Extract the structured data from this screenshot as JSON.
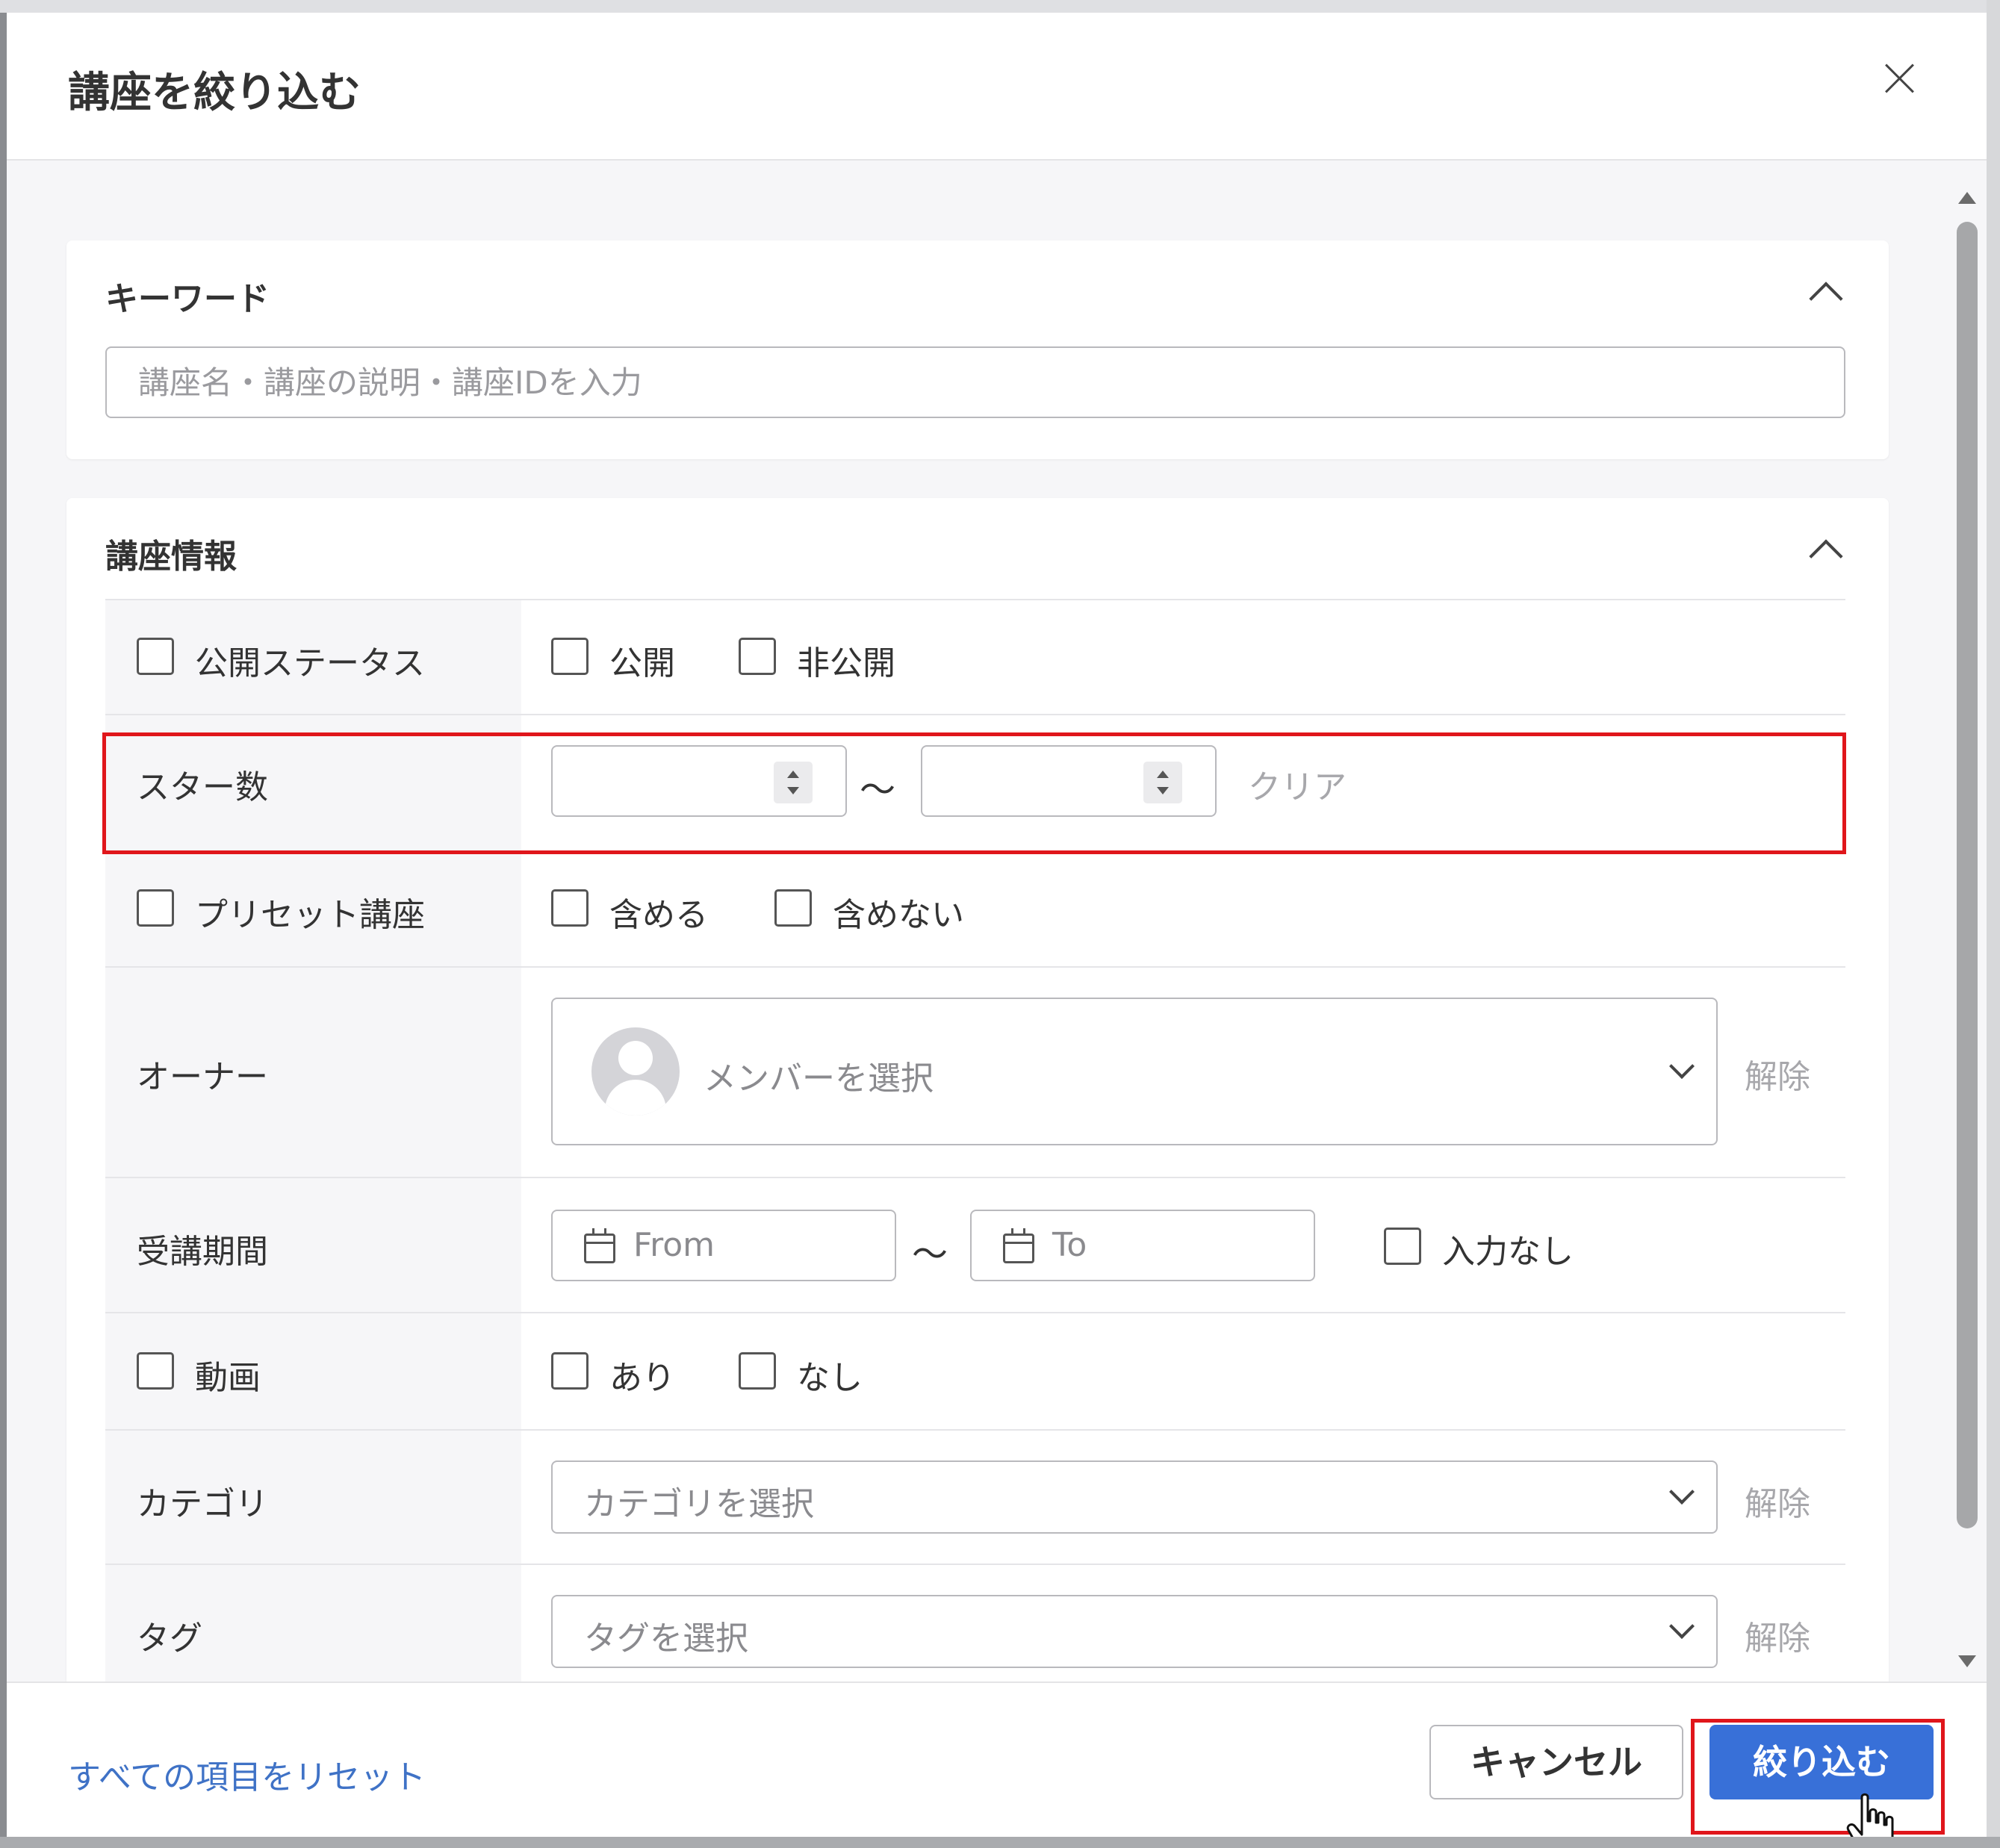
{
  "modal": {
    "title": "講座を絞り込む"
  },
  "keyword": {
    "title": "キーワード",
    "placeholder": "講座名・講座の説明・講座IDを入力"
  },
  "course_info": {
    "title": "講座情報",
    "rows": {
      "status": {
        "label": "公開ステータス",
        "options": [
          "公開",
          "非公開"
        ]
      },
      "stars": {
        "label": "スター数",
        "tilde": "〜",
        "clear": "クリア"
      },
      "preset": {
        "label": "プリセット講座",
        "options": [
          "含める",
          "含めない"
        ]
      },
      "owner": {
        "label": "オーナー",
        "placeholder": "メンバーを選択",
        "clear": "解除"
      },
      "period": {
        "label": "受講期間",
        "from": "From",
        "to": "To",
        "tilde": "〜",
        "none": "入力なし"
      },
      "video": {
        "label": "動画",
        "options": [
          "あり",
          "なし"
        ]
      },
      "category": {
        "label": "カテゴリ",
        "placeholder": "カテゴリを選択",
        "clear": "解除"
      },
      "tag": {
        "label": "タグ",
        "placeholder": "タグを選択",
        "clear": "解除"
      }
    }
  },
  "footer": {
    "reset": "すべての項目をリセット",
    "cancel": "キャンセル",
    "apply": "絞り込む"
  },
  "colors": {
    "accent": "#3870d8",
    "link": "#3f72c6",
    "highlight": "#e0161b"
  }
}
